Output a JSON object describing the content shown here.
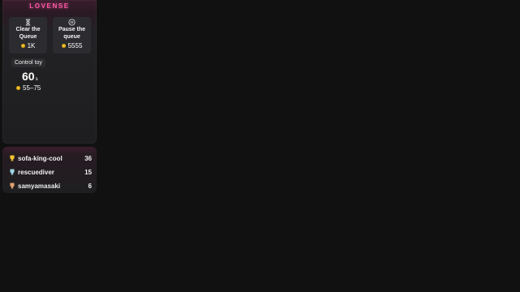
{
  "brand": "LOVENSE",
  "actions": {
    "clear_queue": {
      "label_line1": "Clear the",
      "label_line2": "Queue",
      "price": "1K"
    },
    "pause_queue": {
      "label_line1": "Pause the",
      "label_line2": "queue",
      "price": "5555"
    }
  },
  "control_toy": {
    "label": "Control toy",
    "duration_value": "60",
    "duration_unit": "s",
    "price_range": "55–75"
  },
  "leaderboard": [
    {
      "name": "sofa-king-cool",
      "count": "36",
      "trophy_color": "#f4c430"
    },
    {
      "name": "rescuediver",
      "count": "15",
      "trophy_color": "#9ed6e0"
    },
    {
      "name": "samyamasaki",
      "count": "6",
      "trophy_color": "#e0a070"
    }
  ],
  "colors": {
    "accent": "#ff5aa8",
    "coin": "#f4c430",
    "background": "#111111"
  }
}
